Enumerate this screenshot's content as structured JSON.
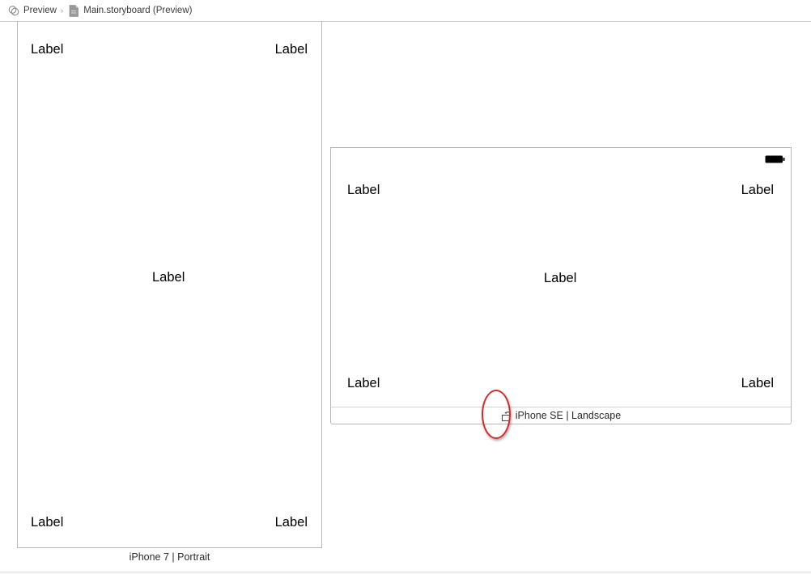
{
  "breadcrumb": {
    "items": [
      {
        "label": "Preview",
        "icon": "assistant-editor-icon"
      },
      {
        "label": "Main.storyboard (Preview)",
        "icon": "storyboard-file-icon"
      }
    ],
    "separator": "›"
  },
  "devices": {
    "portrait": {
      "caption": "iPhone 7 | Portrait",
      "labels": {
        "top_left": "Label",
        "top_right": "Label",
        "center": "Label",
        "bottom_left": "Label",
        "bottom_right": "Label"
      }
    },
    "landscape": {
      "caption": "iPhone SE | Landscape",
      "status_icon": "battery-icon",
      "rotate_icon": "rotate-device-icon",
      "labels": {
        "top_left": "Label",
        "top_right": "Label",
        "center": "Label",
        "bottom_left": "Label",
        "bottom_right": "Label"
      }
    }
  },
  "annotation": {
    "color": "#d42b2b",
    "shape": "oval around rotate button"
  }
}
